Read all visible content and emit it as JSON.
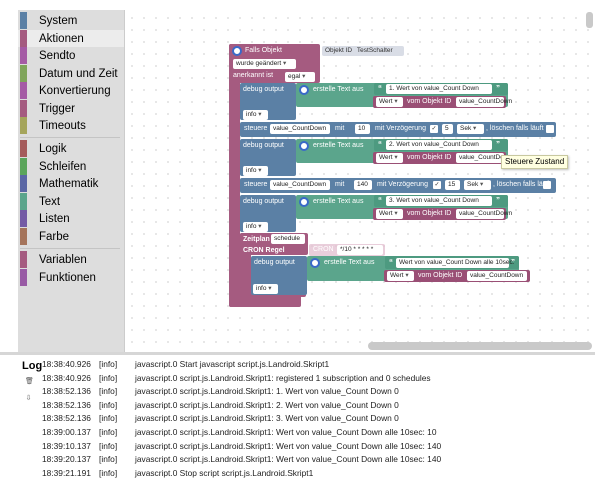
{
  "toolbox": {
    "categories": [
      {
        "label": "System",
        "color": "#5b80a5"
      },
      {
        "label": "Aktionen",
        "color": "#a55b80"
      },
      {
        "label": "Sendto",
        "color": "#a55ba5"
      },
      {
        "label": "Datum und Zeit",
        "color": "#80a55b"
      },
      {
        "label": "Konvertierung",
        "color": "#a55ba5"
      },
      {
        "label": "Trigger",
        "color": "#a55b80"
      },
      {
        "label": "Timeouts",
        "color": "#a5a55b"
      },
      {
        "label": "Logik",
        "color": "#a55b5b"
      },
      {
        "label": "Schleifen",
        "color": "#5ba55b"
      },
      {
        "label": "Mathematik",
        "color": "#5b67a5"
      },
      {
        "label": "Text",
        "color": "#5ba58c"
      },
      {
        "label": "Listen",
        "color": "#745ba5"
      },
      {
        "label": "Farbe",
        "color": "#a5745b"
      },
      {
        "label": "Variablen",
        "color": "#a55b80"
      },
      {
        "label": "Funktionen",
        "color": "#995ba5"
      }
    ]
  },
  "workspace": {
    "trigger": {
      "title": "Falls Objekt",
      "object_id_label": "Objekt ID",
      "object_id_value": "TestSchalter",
      "changed_option": "wurde geändert",
      "ack_label": "anerkannt ist",
      "ack_value": "egal"
    },
    "debug_label": "debug output",
    "create_text_label": "erstelle Text aus",
    "info_option": "info",
    "value_option": "Wert",
    "of_object_label": "vom Objekt ID",
    "value_countdown": "value_CountDown",
    "steuere_label": "steuere",
    "with_label": "mit",
    "delay_label": "mit Verzögerung",
    "unit_option": "Sek",
    "clear_running_label": ", löschen falls läuft",
    "debug1_text": "1. Wert von value_Count Down",
    "debug2_text": "2. Wert von value_Count Down",
    "debug3_text": "3. Wert von value_Count Down",
    "steuere1_value": "10",
    "steuere1_delay": "5",
    "steuere2_value": "140",
    "steuere2_delay": "15",
    "schedule": {
      "title": "Zeitplan",
      "name": "schedule",
      "cron_title": "CRON Regel",
      "cron_label": "CRON",
      "cron_value": "*/10 * * * * *"
    },
    "debug4_text": "Wert von value_Count Down alle 10sec:",
    "tooltip": "Steuere Zustand"
  },
  "log": {
    "title": "Log",
    "entries": [
      {
        "time": "18:38:40.926",
        "level": "[info]",
        "message": "javascript.0 Start javascript script.js.Landroid.Skript1"
      },
      {
        "time": "18:38:40.926",
        "level": "[info]",
        "message": "javascript.0 script.js.Landroid.Skript1: registered 1 subscription and 0 schedules"
      },
      {
        "time": "18:38:52.136",
        "level": "[info]",
        "message": "javascript.0 script.js.Landroid.Skript1: 1. Wert von value_Count Down 0"
      },
      {
        "time": "18:38:52.136",
        "level": "[info]",
        "message": "javascript.0 script.js.Landroid.Skript1: 2. Wert von value_Count Down 0"
      },
      {
        "time": "18:38:52.136",
        "level": "[info]",
        "message": "javascript.0 script.js.Landroid.Skript1: 3. Wert von value_Count Down 0"
      },
      {
        "time": "18:39:00.137",
        "level": "[info]",
        "message": "javascript.0 script.js.Landroid.Skript1: Wert von value_Count Down alle 10sec: 10"
      },
      {
        "time": "18:39:10.137",
        "level": "[info]",
        "message": "javascript.0 script.js.Landroid.Skript1: Wert von value_Count Down alle 10sec: 140"
      },
      {
        "time": "18:39:20.137",
        "level": "[info]",
        "message": "javascript.0 script.js.Landroid.Skript1: Wert von value_Count Down alle 10sec: 140"
      },
      {
        "time": "18:39:21.191",
        "level": "[info]",
        "message": "javascript.0 Stop script script.js.Landroid.Skript1"
      }
    ]
  }
}
